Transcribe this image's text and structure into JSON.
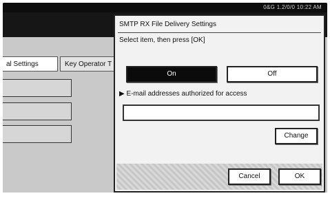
{
  "status": {
    "text": "0&G    1.2/0/0 10:22 AM"
  },
  "tabs": [
    {
      "label": "al Settings"
    },
    {
      "label": "Key Operator T"
    }
  ],
  "dialog": {
    "title": "SMTP RX File Delivery Settings",
    "instruction": "Select item, then press [OK]",
    "on_label": "On",
    "off_label": "Off",
    "selected": "On",
    "email_label": "▶ E-mail addresses authorized for access",
    "email_value": "",
    "change_label": "Change",
    "cancel_label": "Cancel",
    "ok_label": "OK"
  }
}
